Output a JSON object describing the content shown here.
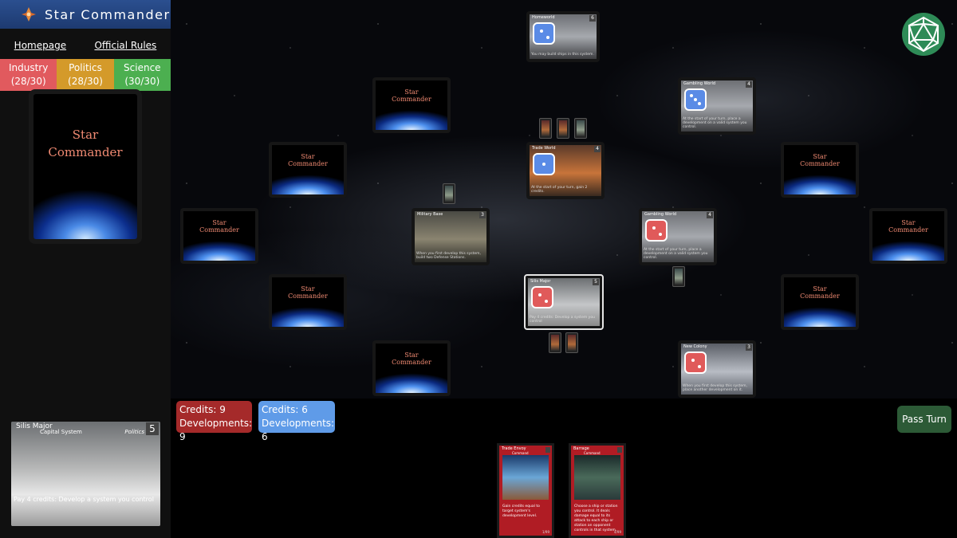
{
  "app": {
    "title": "Star Commander"
  },
  "nav": {
    "homepage": "Homepage",
    "rules": "Official Rules"
  },
  "resources": [
    {
      "label": "Industry",
      "value": "(28/30)",
      "color": "#e15a5e"
    },
    {
      "label": "Politics",
      "value": "(28/30)",
      "color": "#d49a2a"
    },
    {
      "label": "Science",
      "value": "(30/30)",
      "color": "#4caf50"
    }
  ],
  "deck": {
    "title_line1": "Star",
    "title_line2": "Commander"
  },
  "selected_card": {
    "name": "Silis Major",
    "type": "Capital System",
    "affiliation": "Politics",
    "cost": "5",
    "text": "Pay 4 credits: Develop a system you control"
  },
  "card_back": {
    "line1": "Star",
    "line2": "Commander"
  },
  "board_cards": [
    {
      "name": "Homeworld",
      "cost": "6",
      "text": "You may build ships in this system.",
      "die": "blue",
      "pips": 2
    },
    {
      "name": "Gambling World",
      "cost": "4",
      "text": "At the start of your turn, place a development on a valid system you control.",
      "die": "blue",
      "pips": 3
    },
    {
      "name": "Trade World",
      "cost": "4",
      "text": "At the start of your turn, gain 2 credits.",
      "die": "blue",
      "pips": 1
    },
    {
      "name": "Military Base",
      "cost": "3",
      "text": "When you first develop this system, build two Defense Stations.",
      "die": null,
      "pips": 0
    },
    {
      "name": "Gambling World",
      "cost": "4",
      "text": "At the start of your turn, place a development on a valid system you control.",
      "die": "red",
      "pips": 2
    },
    {
      "name": "Silis Major",
      "cost": "5",
      "text": "Pay 4 credits: Develop a system you control",
      "die": "red",
      "pips": 2
    },
    {
      "name": "New Colony",
      "cost": "3",
      "text": "When you first develop this system, place another development on it.",
      "die": "red",
      "pips": 2
    }
  ],
  "players": {
    "red": {
      "credits": "Credits: 9",
      "developments": "Developments: 9",
      "color": "#a52a2a"
    },
    "blue": {
      "credits": "Credits: 6",
      "developments": "Developments: 6",
      "color": "#5f9be8"
    }
  },
  "actions": {
    "pass_turn": "Pass Turn"
  },
  "hand": [
    {
      "name": "Trade Envoy",
      "type": "Command",
      "text": "Gain credits equal to target system's development level.",
      "footer": "1/99"
    },
    {
      "name": "Barrage",
      "type": "Command",
      "text": "Choose a ship or station you control. It deals damage equal to its attack to each ship or station an opponent controls in that system.",
      "footer": "4/99"
    }
  ]
}
